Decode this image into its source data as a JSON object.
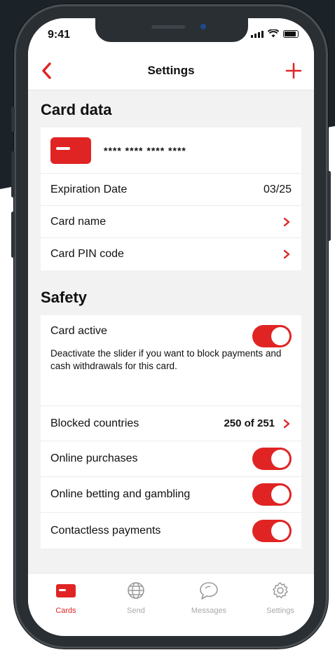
{
  "status_bar": {
    "time": "9:41"
  },
  "nav": {
    "title": "Settings",
    "back_icon": "chevron-left-icon",
    "add_icon": "plus-icon",
    "accent": "#e02424"
  },
  "card_data": {
    "heading": "Card data",
    "card_number": "**** **** **** ****",
    "expiration_label": "Expiration Date",
    "expiration_value": "03/25",
    "card_name_label": "Card name",
    "pin_label": "Card PIN code"
  },
  "safety": {
    "heading": "Safety",
    "card_active_label": "Card active",
    "card_active_on": true,
    "card_active_desc": "Deactivate the slider if you want to block payments and cash withdrawals for this card.",
    "blocked_countries_label": "Blocked countries",
    "blocked_countries_value": "250 of 251",
    "online_purchases_label": "Online purchases",
    "online_purchases_on": true,
    "betting_label": "Online betting and gambling",
    "betting_on": true,
    "contactless_label": "Contactless payments",
    "contactless_on": true
  },
  "tabs": [
    {
      "label": "Cards",
      "icon": "card-icon",
      "active": true
    },
    {
      "label": "Send",
      "icon": "globe-icon",
      "active": false
    },
    {
      "label": "Messages",
      "icon": "chat-bubble-icon",
      "active": false
    },
    {
      "label": "Settings",
      "icon": "gear-icon",
      "active": false
    }
  ]
}
